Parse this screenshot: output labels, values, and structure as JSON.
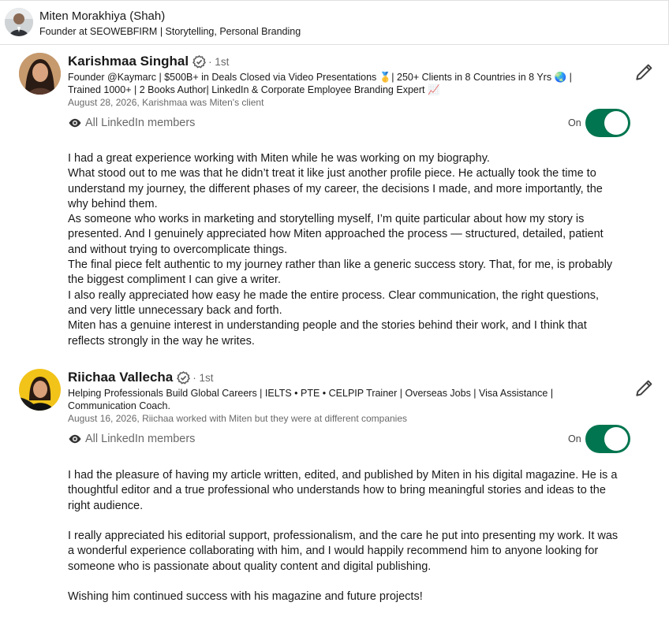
{
  "owner": {
    "name": "Miten Morakhiya (Shah)",
    "headline": "Founder at SEOWEBFIRM | Storytelling, Personal Branding"
  },
  "recommendations": [
    {
      "name": "Karishmaa Singhal",
      "degree": "· 1st",
      "headline": "Founder @Kaymarc  | $500B+ in Deals Closed via Video Presentations 🥇| 250+ Clients in 8 Countries in 8 Yrs 🌏 | Trained 1000+ | 2 Books Author|  LinkedIn & Corporate Employee Branding Expert 📈",
      "meta": "August 28, 2026, Karishmaa was Miten's client",
      "visibility": "All LinkedIn members",
      "toggle_label": "On",
      "toggle_on": true,
      "body": [
        "I had a great experience working with Miten while he was working on my biography.",
        "What stood out to me was that he didn’t treat it like just another profile piece. He actually took the time to understand my journey, the different phases of my career, the decisions I made, and more importantly, the why behind them.",
        "As someone who works in marketing and storytelling myself, I’m quite particular about how my story is presented. And I genuinely appreciated how Miten approached the process — structured, detailed, patient and without trying to overcomplicate things.",
        "The final piece felt authentic to my journey rather than like a generic success story. That, for me, is probably the biggest compliment I can give a writer.",
        "I also really appreciated how easy he made the entire process. Clear communication, the right questions, and very little unnecessary back and forth.",
        "Miten has a genuine interest in understanding people and the stories behind their work, and I think that reflects strongly in the way he writes."
      ]
    },
    {
      "name": "Riichaa Vallecha",
      "degree": "· 1st",
      "headline": "Helping Professionals Build Global Careers | IELTS • PTE • CELPIP Trainer | Overseas Jobs | Visa Assistance | Communication Coach.",
      "meta": "August 16, 2026, Riichaa worked with Miten but they were at different companies",
      "visibility": "All LinkedIn members",
      "toggle_label": "On",
      "toggle_on": true,
      "body": [
        "I had the pleasure of having my article written, edited, and published by Miten in his digital magazine. He is a thoughtful editor and a true professional who understands how to bring meaningful stories and ideas to the right audience.",
        "",
        "I really appreciated his editorial support, professionalism, and the care he put into presenting my work. It was a wonderful experience collaborating with him, and I would happily recommend him to anyone looking for someone who is passionate about quality content and digital publishing.",
        "",
        "Wishing him continued success with his magazine and future projects!"
      ]
    }
  ],
  "colors": {
    "toggle_on": "#01754f",
    "verified": "#5e5e5e"
  },
  "icons": {
    "verified": "verified-badge-icon",
    "visibility": "eye-icon",
    "edit": "pencil-icon"
  }
}
